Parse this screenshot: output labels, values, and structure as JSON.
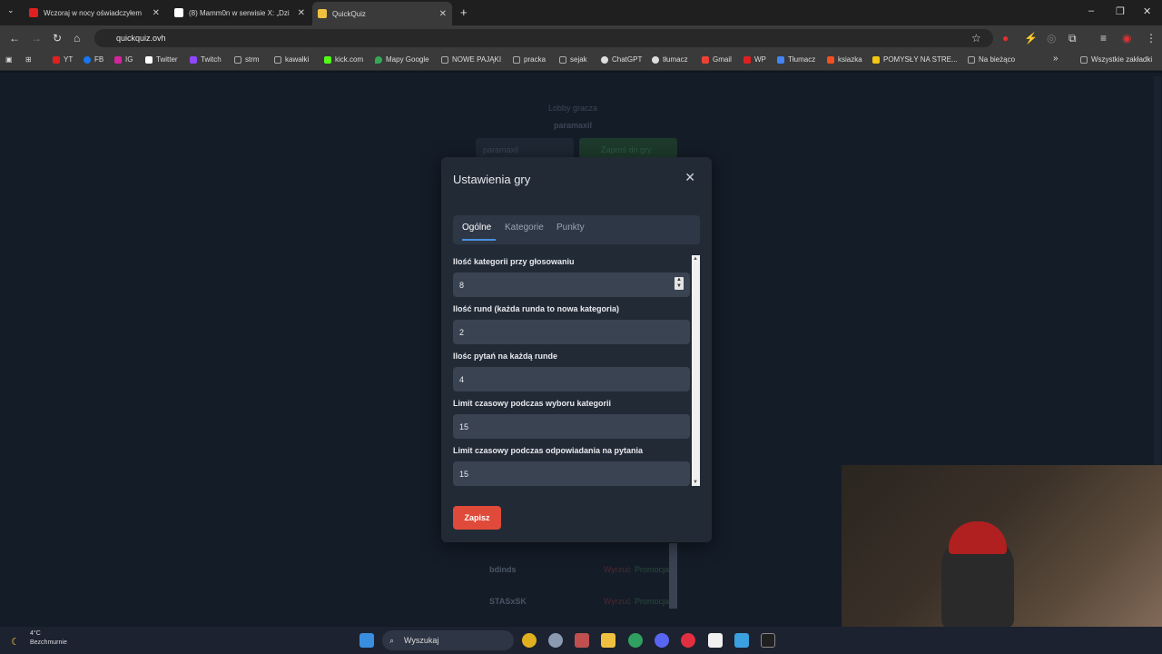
{
  "browser": {
    "tabs": [
      {
        "title": "Wczoraj w nocy oświadczyłem",
        "favicon_color": "#e02020"
      },
      {
        "title": "(8) Mamm0n w serwisie X: „Dzi",
        "favicon_color": "#ffffff"
      },
      {
        "title": "QuickQuiz",
        "favicon_color": "#f0c040"
      }
    ],
    "url": "quickquiz.ovh",
    "bookmarks": [
      {
        "label": "YT",
        "color": "#e02020"
      },
      {
        "label": "FB",
        "color": "#1877f2"
      },
      {
        "label": "IG",
        "color": "#d6249f"
      },
      {
        "label": "Twitter",
        "color": "#ffffff"
      },
      {
        "label": "Twitch",
        "color": "#9146ff"
      },
      {
        "label": "strm",
        "color": "#aaaaaa"
      },
      {
        "label": "kawałki",
        "color": "#aaaaaa"
      },
      {
        "label": "kick.com",
        "color": "#53fc18"
      },
      {
        "label": "Mapy Google",
        "color": "#34a853"
      },
      {
        "label": "NOWE PAJĄKI",
        "color": "#aaaaaa"
      },
      {
        "label": "pracka",
        "color": "#aaaaaa"
      },
      {
        "label": "sejak",
        "color": "#aaaaaa"
      },
      {
        "label": "ChatGPT",
        "color": "#dddddd"
      },
      {
        "label": "tłumacz",
        "color": "#dddddd"
      },
      {
        "label": "Gmail",
        "color": "#ea4335"
      },
      {
        "label": "WP",
        "color": "#e02020"
      },
      {
        "label": "Tłumacz",
        "color": "#4285f4"
      },
      {
        "label": "ksiazka",
        "color": "#f25022"
      },
      {
        "label": "POMYSŁY NA STRE...",
        "color": "#f2c811"
      },
      {
        "label": "Na bieżąco",
        "color": "#aaaaaa"
      }
    ],
    "all_bookmarks": "Wszystkie zakładki"
  },
  "background": {
    "lobby_title": "Lobby gracza",
    "lobby_owner": "paramaxil",
    "player_input": "paramaxil",
    "invite_button": "Zaproś do gry",
    "players": [
      {
        "name": "bdinds",
        "action1": "Wyrzuć",
        "action2": "Promocja"
      },
      {
        "name": "STASxSK",
        "action1": "Wyrzuć",
        "action2": "Promocja"
      }
    ]
  },
  "modal": {
    "title": "Ustawienia gry",
    "tabs": [
      "Ogólne",
      "Kategorie",
      "Punkty"
    ],
    "active_tab": "Ogólne",
    "fields": [
      {
        "label": "Ilość kategorii przy głosowaniu",
        "value": "8"
      },
      {
        "label": "Ilość rund (każda runda to nowa kategoria)",
        "value": "2"
      },
      {
        "label": "Ilośc pytań na każdą runde",
        "value": "4"
      },
      {
        "label": "Limit czasowy podczas wyboru kategorii",
        "value": "15"
      },
      {
        "label": "Limit czasowy podczas odpowiadania na pytania",
        "value": "15"
      }
    ],
    "save_label": "Zapisz"
  },
  "taskbar": {
    "weather_temp": "4°C",
    "weather_desc": "Bezchmurnie",
    "search_label": "Wyszukaj"
  },
  "colors": {
    "accent_blue": "#4a90e2",
    "save_red": "#e04a3a",
    "modal_bg": "#222a36"
  }
}
